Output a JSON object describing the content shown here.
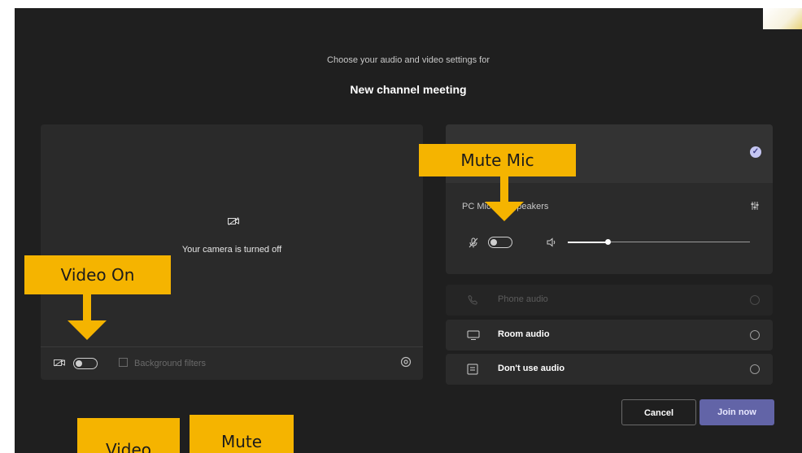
{
  "dialog": {
    "subtitle": "Choose your audio and video settings for",
    "title": "New channel meeting"
  },
  "preview": {
    "camera_off_text": "Your camera is turned off",
    "background_filters_label": "Background filters"
  },
  "audio": {
    "speakers_label": "PC Mic and Speakers",
    "volume_level": 0.22,
    "options": [
      {
        "label": "Phone audio",
        "enabled": false
      },
      {
        "label": "Room audio",
        "enabled": true
      },
      {
        "label": "Don't use audio",
        "enabled": true
      }
    ]
  },
  "buttons": {
    "cancel": "Cancel",
    "join": "Join now"
  },
  "callouts": {
    "mute_mic": "Mute Mic",
    "video_on": "Video On",
    "video_bottom": "Video",
    "mute_bottom": "Mute"
  },
  "colors": {
    "accent": "#6264a7",
    "callout": "#f5b400",
    "background": "#1f1f1f"
  }
}
